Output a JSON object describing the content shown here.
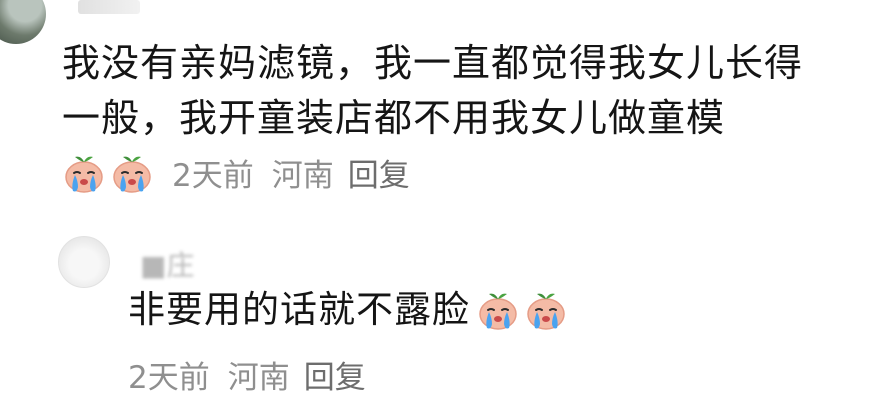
{
  "comment": {
    "text": "我没有亲妈滤镜，我一直都觉得我女儿长得一般，我开童装店都不用我女儿做童模",
    "emojis": [
      "crying-face-icon",
      "crying-face-icon"
    ],
    "time": "2天前",
    "location": "河南",
    "reply_label": "回复"
  },
  "reply": {
    "username": "■庄",
    "text": "非要用的话就不露脸",
    "emojis": [
      "crying-face-icon",
      "crying-face-icon"
    ],
    "time": "2天前",
    "location": "河南",
    "reply_label": "回复"
  },
  "colors": {
    "text": "#151515",
    "meta": "#8f8f8f",
    "emoji_face": "#f3b7a3",
    "emoji_tear": "#4aa3f0",
    "emoji_leaf": "#3f8f3a"
  }
}
